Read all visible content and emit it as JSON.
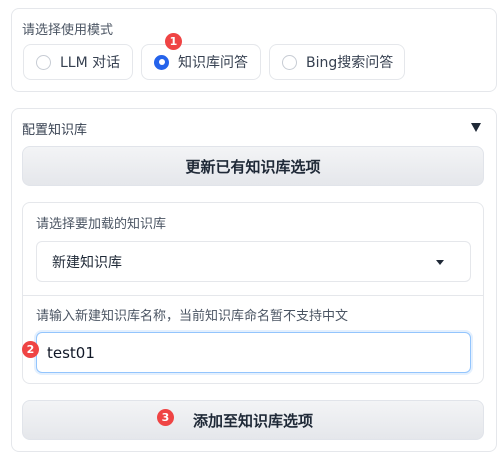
{
  "mode_section": {
    "label": "请选择使用模式",
    "options": [
      {
        "label": "LLM 对话",
        "selected": false
      },
      {
        "label": "知识库问答",
        "selected": true
      },
      {
        "label": "Bing搜索问答",
        "selected": false
      }
    ]
  },
  "kb_section": {
    "header": "配置知识库",
    "update_button": "更新已有知识库选项",
    "select_label": "请选择要加载的知识库",
    "select_value": "新建知识库",
    "name_label": "请输入新建知识库名称，当前知识库命名暂不支持中文",
    "name_value": "test01",
    "add_button": "添加至知识库选项"
  },
  "markers": [
    "1",
    "2",
    "3"
  ],
  "colors": {
    "accent": "#2563eb",
    "marker": "#ef4444",
    "focus_border": "#93c5fd"
  }
}
